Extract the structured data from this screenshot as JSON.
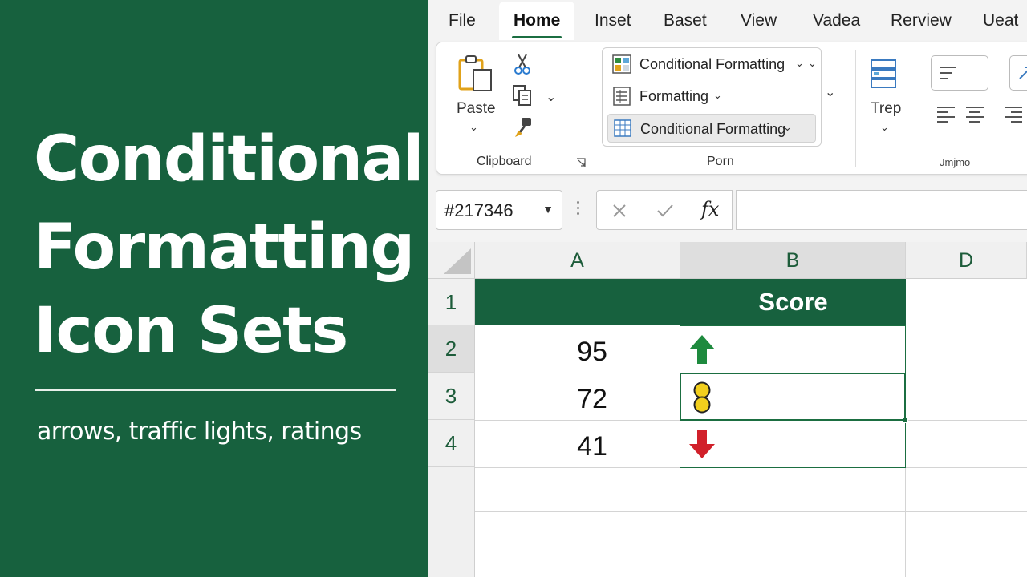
{
  "title_panel": {
    "line1": "Conditional",
    "line2": "Formatting",
    "line3": "Icon Sets",
    "subtitle": "arrows, traffic lights, ratings",
    "background": "#17613e"
  },
  "tabs": [
    "File",
    "Home",
    "Inset",
    "Baset",
    "View",
    "Vadea",
    "Rerview",
    "Ueat"
  ],
  "active_tab": "Home",
  "ribbon": {
    "clipboard": {
      "paste_label": "Paste",
      "group_label": "Clipboard",
      "icons": [
        "paste-icon",
        "cut-icon",
        "copy-icon",
        "format-painter-icon",
        "dialog-launcher-icon"
      ]
    },
    "styles": {
      "items": [
        {
          "label": "Conditional Formatting",
          "icon": "conditional-formatting-icon"
        },
        {
          "label": "Formatting",
          "icon": "format-as-table-icon"
        },
        {
          "label": "Conditional Formatting",
          "icon": "cell-styles-icon"
        }
      ],
      "group_label": "Porn"
    },
    "cells": {
      "label": "Trep",
      "icon": "insert-table-icon"
    },
    "alignment": {
      "group_label": "Jmjmo"
    }
  },
  "formula_bar": {
    "name_box": "#217346",
    "fx_label": "fx",
    "formula": ""
  },
  "grid": {
    "columns": [
      "A",
      "B",
      "D"
    ],
    "rows": [
      "1",
      "2",
      "3",
      "4"
    ],
    "header": {
      "B1": "Score"
    },
    "values": [
      "95",
      "72",
      "41"
    ],
    "icons": [
      "arrow-up-green",
      "traffic-light-yellow",
      "arrow-down-red"
    ],
    "colors": {
      "header_fill": "#17613e",
      "up_arrow": "#1e8a3e",
      "down_arrow": "#d1202a",
      "yellow": "#f2cf1d"
    }
  }
}
